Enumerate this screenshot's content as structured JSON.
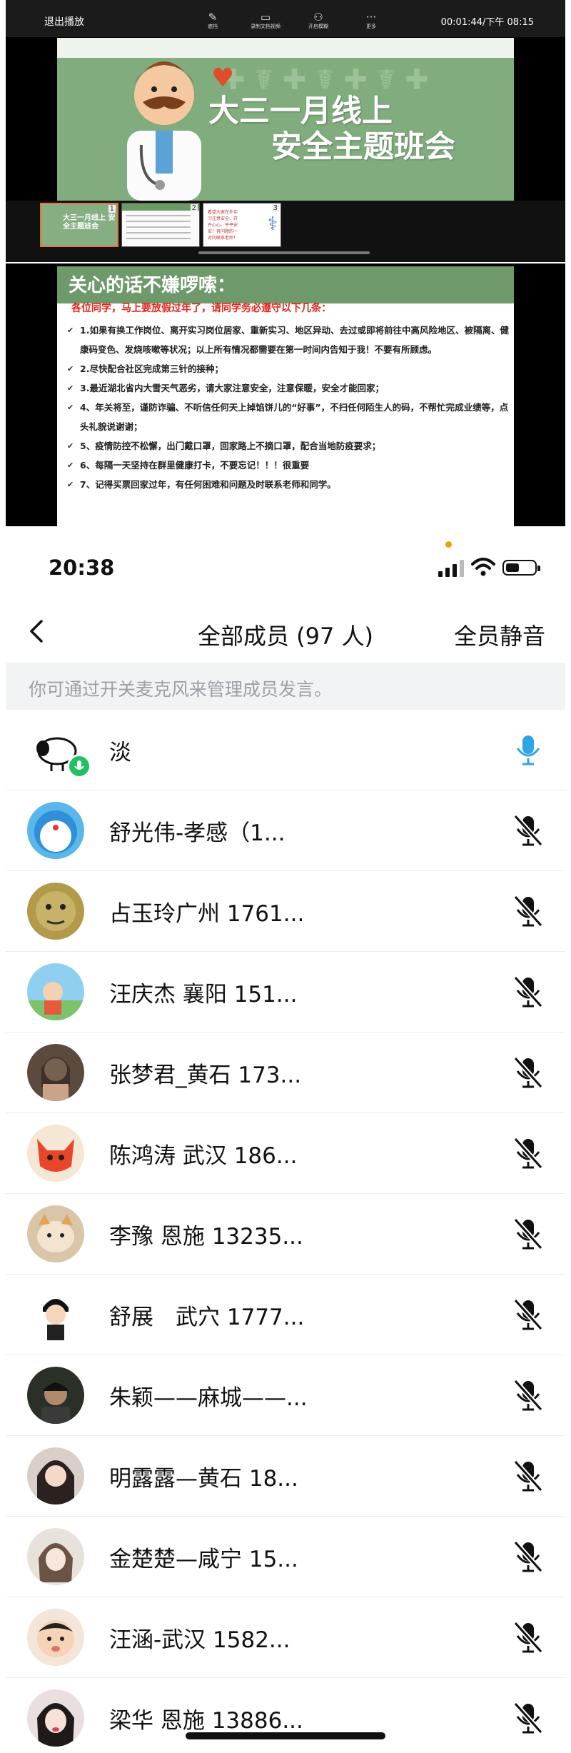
{
  "playback": {
    "exit_label": "退出播放",
    "tools": [
      {
        "icon": "brush-icon",
        "label": "遮挡"
      },
      {
        "icon": "video-record-icon",
        "label": "录制文档视频"
      },
      {
        "icon": "person-icon",
        "label": "开启模糊"
      },
      {
        "icon": "more-icon",
        "label": "更多"
      }
    ],
    "timestamp": "00:01:44/下午 08:15",
    "slide_title_line1": "大三一月线上",
    "slide_title_line2": "安全主题班会",
    "thumbnails": [
      {
        "number": "1",
        "text": "大三一月线上 安全主题班会"
      },
      {
        "number": "2",
        "text": ""
      },
      {
        "number": "3",
        "text": "看望大家在外实习注意安全、开开心心、平平安安！有问题的一对问联系老师！"
      }
    ]
  },
  "slide2": {
    "heading": "关心的话不嫌啰嗦：",
    "subheading": "各位同学，马上要放假过年了，请同学务必遵守以下几条：",
    "items": [
      "1.如果有换工作岗位、离开实习岗位居家、重新实习、地区异动、去过或即将前往中高风险地区、被隔离、健康码变色、发烧咳嗽等状况；以上所有情况都需要在第一时间内告知于我！不要有所顾虑。",
      "2.尽快配合社区完成第三针的接种；",
      "3.最近湖北省内大雪天气恶劣，请大家注意安全，注意保暖，安全才能回家；",
      "4、年关将至，谨防诈骗、不听信任何天上掉馅饼儿的“好事”，不扫任何陌生人的码，不帮忙完成业绩等，点头礼貌说谢谢；",
      "5、疫情防控不松懈，出门戴口罩，回家路上不摘口罩，配合当地防疫要求；",
      "6、每隔一天坚持在群里健康打卡，不要忘记！！！很重要",
      "7、记得买票回家过年，有任何困难和问题及时联系老师和同学。"
    ]
  },
  "status_bar": {
    "time": "20:38"
  },
  "header": {
    "back_icon": "chevron-left-icon",
    "title": "全部成员 (97 人)",
    "mute_all_label": "全员静音"
  },
  "hint_text": "你可通过开关麦克风来管理成员发言。",
  "members": [
    {
      "name": "淡",
      "mic": "on"
    },
    {
      "name": "舒光伟-孝感（1...",
      "mic": "off"
    },
    {
      "name": "占玉玲广州 1761...",
      "mic": "off"
    },
    {
      "name": "汪庆杰 襄阳 151...",
      "mic": "off"
    },
    {
      "name": "张梦君_黄石 173...",
      "mic": "off"
    },
    {
      "name": "陈鸿涛 武汉 186...",
      "mic": "off"
    },
    {
      "name": "李豫 恩施 13235...",
      "mic": "off"
    },
    {
      "name": "舒展　武穴 1777...",
      "mic": "off"
    },
    {
      "name": "朱颖——麻城——...",
      "mic": "off"
    },
    {
      "name": "明露露—黄石  18...",
      "mic": "off"
    },
    {
      "name": "金楚楚—咸宁 15...",
      "mic": "off"
    },
    {
      "name": "汪涵-武汉 1582...",
      "mic": "off"
    },
    {
      "name": "梁华 恩施 13886...",
      "mic": "off"
    }
  ],
  "colors": {
    "mic_on": "#2fa4e7",
    "mic_off": "#111111",
    "badge": "#21c161",
    "slide_green": "#80ac7e",
    "alert_red": "#e3251b"
  }
}
